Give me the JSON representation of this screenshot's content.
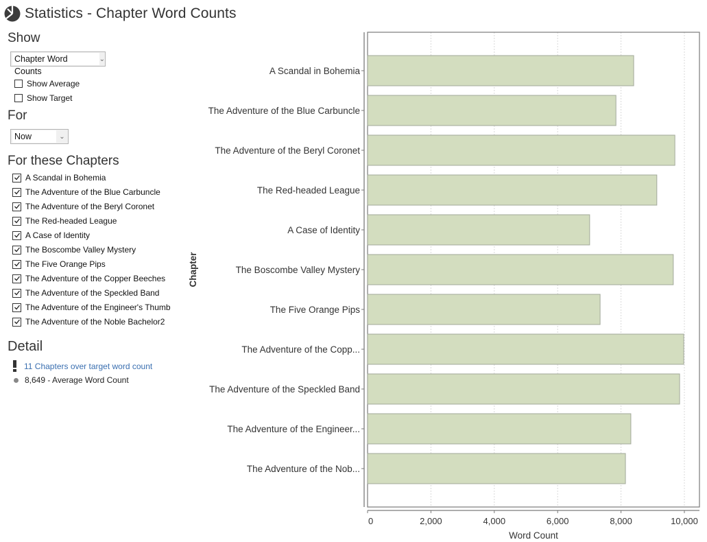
{
  "window": {
    "title": "Statistics - Chapter Word Counts",
    "icon": "pie-chart-icon"
  },
  "sidebar": {
    "show_heading": "Show",
    "show_select": {
      "value": "Chapter Word Counts"
    },
    "options": [
      {
        "label": "Show Average",
        "checked": false
      },
      {
        "label": "Show Target",
        "checked": false
      }
    ],
    "for_heading": "For",
    "for_select": {
      "value": "Now"
    },
    "chapters_heading": "For these Chapters",
    "chapters": [
      {
        "label": "A Scandal in Bohemia",
        "checked": true
      },
      {
        "label": "The Adventure of the Blue Carbuncle",
        "checked": true
      },
      {
        "label": "The Adventure of the Beryl Coronet",
        "checked": true
      },
      {
        "label": "The Red-headed League",
        "checked": true
      },
      {
        "label": "A Case of Identity",
        "checked": true
      },
      {
        "label": "The Boscombe Valley Mystery",
        "checked": true
      },
      {
        "label": "The Five Orange Pips",
        "checked": true
      },
      {
        "label": "The Adventure of the Copper Beeches",
        "checked": true
      },
      {
        "label": "The Adventure of the Speckled Band",
        "checked": true
      },
      {
        "label": "The Adventure of the Engineer's Thumb",
        "checked": true
      },
      {
        "label": "The Adventure of the Noble Bachelor2",
        "checked": true
      }
    ],
    "detail_heading": "Detail",
    "detail": {
      "over_target": {
        "icon": "exclamation-icon",
        "text": "11 Chapters over target word count"
      },
      "average": {
        "icon": "dot-icon",
        "text": "8,649 - Average Word Count"
      }
    }
  },
  "colors": {
    "bar_fill": "#d3ddbf",
    "bar_stroke": "#a2a89a",
    "link": "#3a6fb0"
  },
  "chart_data": {
    "type": "bar",
    "orientation": "horizontal",
    "title": "",
    "xlabel": "Word Count",
    "ylabel": "Chapter",
    "xlim": [
      0,
      10500
    ],
    "xticks": [
      0,
      2000,
      4000,
      6000,
      8000,
      10000
    ],
    "xtick_labels": [
      "0",
      "2,000",
      "4,000",
      "6,000",
      "8,000",
      "10,000"
    ],
    "grid": "vertical-dotted",
    "legend": "none",
    "categories": [
      "A Scandal in Bohemia",
      "The Adventure of the Blue Carbuncle",
      "The Adventure of the Beryl Coronet",
      "The Red-headed League",
      "A Case of Identity",
      "The Boscombe Valley Mystery",
      "The Five Orange Pips",
      "The Adventure of the Copp...",
      "The Adventure of the Speckled Band",
      "The Adventure of the Engineer...",
      "The Adventure of the Nob..."
    ],
    "values": [
      8400,
      7840,
      9700,
      9130,
      7010,
      9650,
      7340,
      9980,
      9850,
      8310,
      8140
    ]
  }
}
